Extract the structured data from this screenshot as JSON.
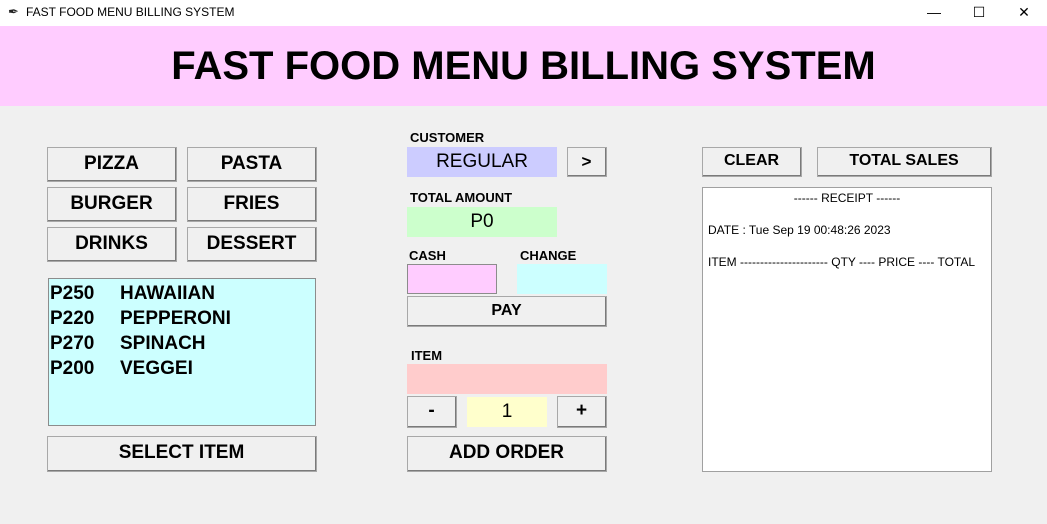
{
  "window": {
    "title": "FAST FOOD MENU BILLING SYSTEM",
    "controls": {
      "minimize": "—",
      "maximize": "☐",
      "close": "✕"
    }
  },
  "header": {
    "title": "FAST FOOD MENU BILLING SYSTEM"
  },
  "categories": {
    "pizza": "PIZZA",
    "pasta": "PASTA",
    "burger": "BURGER",
    "fries": "FRIES",
    "drinks": "DRINKS",
    "dessert": "DESSERT"
  },
  "menu_items": [
    {
      "price": "P250",
      "name": "HAWAIIAN"
    },
    {
      "price": "P220",
      "name": "PEPPERONI"
    },
    {
      "price": "P270",
      "name": "SPINACH"
    },
    {
      "price": "P200",
      "name": "VEGGEI"
    }
  ],
  "select_item_label": "SELECT ITEM",
  "customer": {
    "label": "CUSTOMER",
    "value": "REGULAR",
    "next_label": ">"
  },
  "total_amount": {
    "label": "TOTAL AMOUNT",
    "value": "P0"
  },
  "cash": {
    "label": "CASH",
    "value": ""
  },
  "change": {
    "label": "CHANGE",
    "value": ""
  },
  "pay_label": "PAY",
  "item": {
    "label": "ITEM",
    "value": ""
  },
  "quantity": {
    "minus": "-",
    "value": "1",
    "plus": "+"
  },
  "add_order_label": "ADD ORDER",
  "clear_label": "CLEAR",
  "total_sales_label": "TOTAL SALES",
  "receipt": {
    "header": "------ RECEIPT ------",
    "date_line": "DATE : Tue Sep 19 00:48:26 2023",
    "columns_line": "ITEM ---------------------- QTY ---- PRICE ---- TOTAL"
  },
  "colors": {
    "banner": "#ffccff",
    "customer_field": "#ccccff",
    "total_field": "#ccffcc",
    "cash_field": "#ffccff",
    "change_field": "#ccffff",
    "item_field": "#ffcccc",
    "qty_field": "#ffffcc",
    "menu_list": "#ccffff"
  },
  "icons": {
    "app": "feather-icon"
  }
}
